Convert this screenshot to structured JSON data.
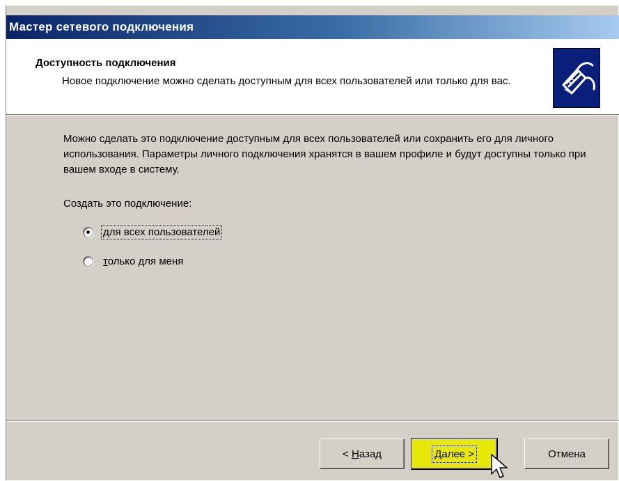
{
  "window": {
    "title": "Мастер сетевого подключения"
  },
  "header": {
    "title": "Доступность подключения",
    "subtitle": "Новое подключение можно сделать доступным для всех пользователей или только для вас.",
    "icon": "network-cable-icon"
  },
  "main": {
    "description": "Можно сделать это подключение доступным для всех пользователей или сохранить его для личного использования. Параметры личного подключения хранятся в вашем профиле и будут доступны только при вашем входе в систему.",
    "create_label": "Создать это подключение:",
    "options": [
      {
        "label_prefix": "",
        "label_accel": "д",
        "label_rest": "ля всех пользователей",
        "selected": true
      },
      {
        "label_prefix": "",
        "label_accel": "т",
        "label_rest": "олько для меня",
        "selected": false
      }
    ]
  },
  "buttons": {
    "back_prefix": "< ",
    "back_accel": "Н",
    "back_rest": "азад",
    "next_label": "Далее >",
    "cancel_label": "Отмена"
  },
  "colors": {
    "face": "#d4d0c8",
    "title_dark": "#0a246a",
    "title_light": "#a6caf0",
    "highlight_button": "#e8e808"
  }
}
